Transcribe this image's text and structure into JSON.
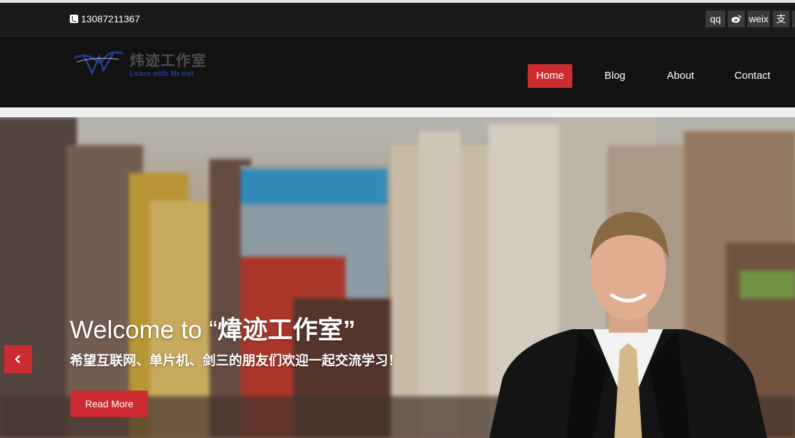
{
  "topbar": {
    "phone": "13087211367",
    "social": [
      "qq",
      "weibo",
      "weix",
      "支"
    ]
  },
  "logo": {
    "title": "炜迹工作室",
    "subtitle": "Learn with Mr.wei"
  },
  "nav": {
    "items": [
      "Home",
      "Blog",
      "About",
      "Contact"
    ],
    "active": "Home"
  },
  "hero": {
    "title_prefix": "Welcome to “",
    "title_name": "煒迹工作室”",
    "subtitle": "希望互联网、单片机、剑三的朋友们欢迎一起交流学习！",
    "button": "Read More"
  },
  "colors": {
    "accent": "#cc2b2f",
    "topbar": "#1b1b1b",
    "navbar": "#121212"
  }
}
